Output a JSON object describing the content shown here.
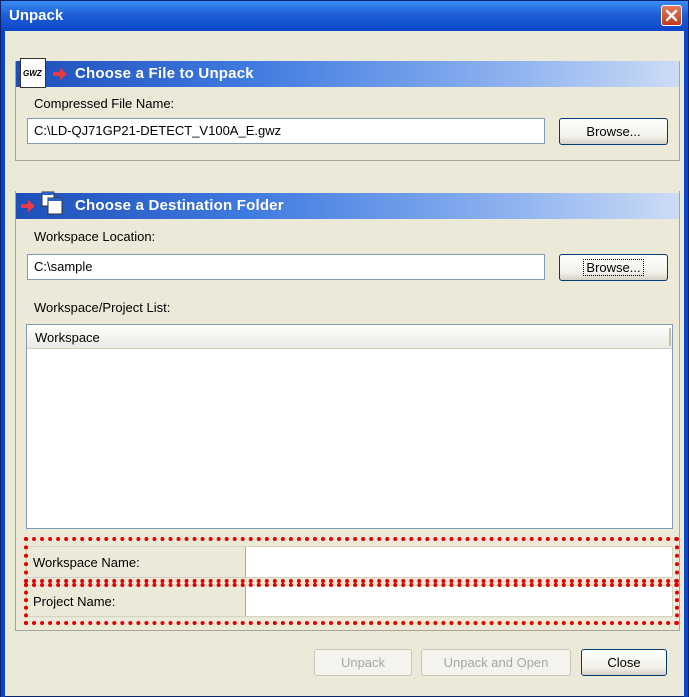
{
  "window": {
    "title": "Unpack"
  },
  "colors": {
    "titlebar": "#1f5fd8",
    "section_header": "#3f7ae0",
    "highlight_box": "#e00000",
    "arrow": "#e8394a"
  },
  "icons": {
    "file_icon_text": "GWZ",
    "close": "close-icon",
    "file": "gwz-file-icon",
    "arrow": "red-arrow-icon",
    "folder": "folder-windows-icon"
  },
  "file_section": {
    "header": "Choose a File to Unpack",
    "label": "Compressed File Name:",
    "value": "C:\\LD-QJ71GP21-DETECT_V100A_E.gwz",
    "browse_label": "Browse..."
  },
  "dest_section": {
    "header": "Choose a Destination Folder",
    "location_label": "Workspace Location:",
    "location_value": "C:\\sample",
    "browse_label": "Browse...",
    "list_label": "Workspace/Project List:",
    "list_column": "Workspace",
    "workspace_name_label": "Workspace Name:",
    "workspace_name_value": "",
    "project_name_label": "Project Name:",
    "project_name_value": ""
  },
  "footer": {
    "unpack_label": "Unpack",
    "unpack_open_label": "Unpack and Open",
    "close_label": "Close"
  }
}
